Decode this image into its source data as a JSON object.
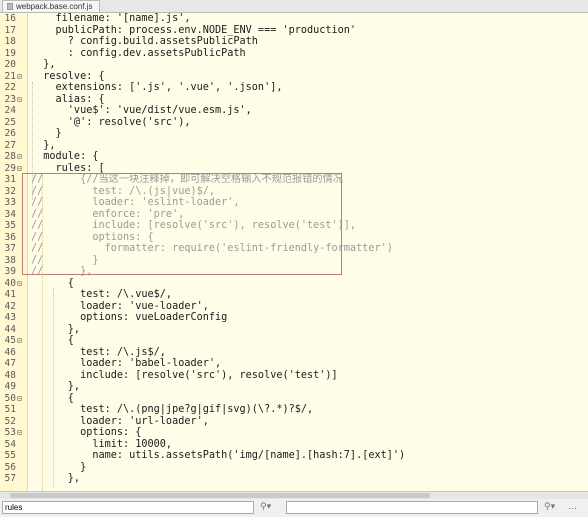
{
  "editor": {
    "tab_title": "webpack.base.conf.js",
    "lines": [
      {
        "num": "16",
        "fold": "",
        "code": "    filename: '[name].js',"
      },
      {
        "num": "17",
        "fold": "",
        "code": "    publicPath: process.env.NODE_ENV === 'production'"
      },
      {
        "num": "18",
        "fold": "",
        "code": "      ? config.build.assetsPublicPath"
      },
      {
        "num": "19",
        "fold": "",
        "code": "      : config.dev.assetsPublicPath"
      },
      {
        "num": "20",
        "fold": "",
        "code": "  },"
      },
      {
        "num": "21",
        "fold": "⊟",
        "code": "  resolve: {"
      },
      {
        "num": "22",
        "fold": "",
        "code": "    extensions: ['.js', '.vue', '.json'],"
      },
      {
        "num": "23",
        "fold": "⊟",
        "code": "    alias: {"
      },
      {
        "num": "24",
        "fold": "",
        "code": "      'vue$': 'vue/dist/vue.esm.js',"
      },
      {
        "num": "25",
        "fold": "",
        "code": "      '@': resolve('src'),"
      },
      {
        "num": "26",
        "fold": "",
        "code": "    }"
      },
      {
        "num": "27",
        "fold": "",
        "code": "  },"
      },
      {
        "num": "28",
        "fold": "⊟",
        "code": "  module: {"
      },
      {
        "num": "29",
        "fold": "⊟",
        "code": "    rules: ["
      },
      {
        "num": "31",
        "fold": "",
        "code": "//      {//当这一块注释掉，即可解决空格输入不规范报错的情况"
      },
      {
        "num": "32",
        "fold": "",
        "code": "//        test: /\\.(js|vue)$/,"
      },
      {
        "num": "33",
        "fold": "",
        "code": "//        loader: 'eslint-loader',"
      },
      {
        "num": "34",
        "fold": "",
        "code": "//        enforce: 'pre',"
      },
      {
        "num": "35",
        "fold": "",
        "code": "//        include: [resolve('src'), resolve('test')],"
      },
      {
        "num": "36",
        "fold": "",
        "code": "//        options: {"
      },
      {
        "num": "37",
        "fold": "",
        "code": "//          formatter: require('eslint-friendly-formatter')"
      },
      {
        "num": "38",
        "fold": "",
        "code": "//        }"
      },
      {
        "num": "39",
        "fold": "",
        "code": "//      },"
      },
      {
        "num": "40",
        "fold": "⊟",
        "code": "      {"
      },
      {
        "num": "41",
        "fold": "",
        "code": "        test: /\\.vue$/,"
      },
      {
        "num": "42",
        "fold": "",
        "code": "        loader: 'vue-loader',"
      },
      {
        "num": "43",
        "fold": "",
        "code": "        options: vueLoaderConfig"
      },
      {
        "num": "44",
        "fold": "",
        "code": "      },"
      },
      {
        "num": "45",
        "fold": "⊟",
        "code": "      {"
      },
      {
        "num": "46",
        "fold": "",
        "code": "        test: /\\.js$/,"
      },
      {
        "num": "47",
        "fold": "",
        "code": "        loader: 'babel-loader',"
      },
      {
        "num": "48",
        "fold": "",
        "code": "        include: [resolve('src'), resolve('test')]"
      },
      {
        "num": "49",
        "fold": "",
        "code": "      },"
      },
      {
        "num": "50",
        "fold": "⊟",
        "code": "      {"
      },
      {
        "num": "51",
        "fold": "",
        "code": "        test: /\\.(png|jpe?g|gif|svg)(\\?.*)?$/,"
      },
      {
        "num": "52",
        "fold": "",
        "code": "        loader: 'url-loader',"
      },
      {
        "num": "53",
        "fold": "⊟",
        "code": "        options: {"
      },
      {
        "num": "54",
        "fold": "",
        "code": "          limit: 10000,"
      },
      {
        "num": "55",
        "fold": "",
        "code": "          name: utils.assetsPath('img/[name].[hash:7].[ext]')"
      },
      {
        "num": "56",
        "fold": "",
        "code": "        }"
      },
      {
        "num": "57",
        "fold": "",
        "code": "      },"
      }
    ]
  },
  "statusbar": {
    "search_value": "rules",
    "search_placeholder": "rules"
  }
}
